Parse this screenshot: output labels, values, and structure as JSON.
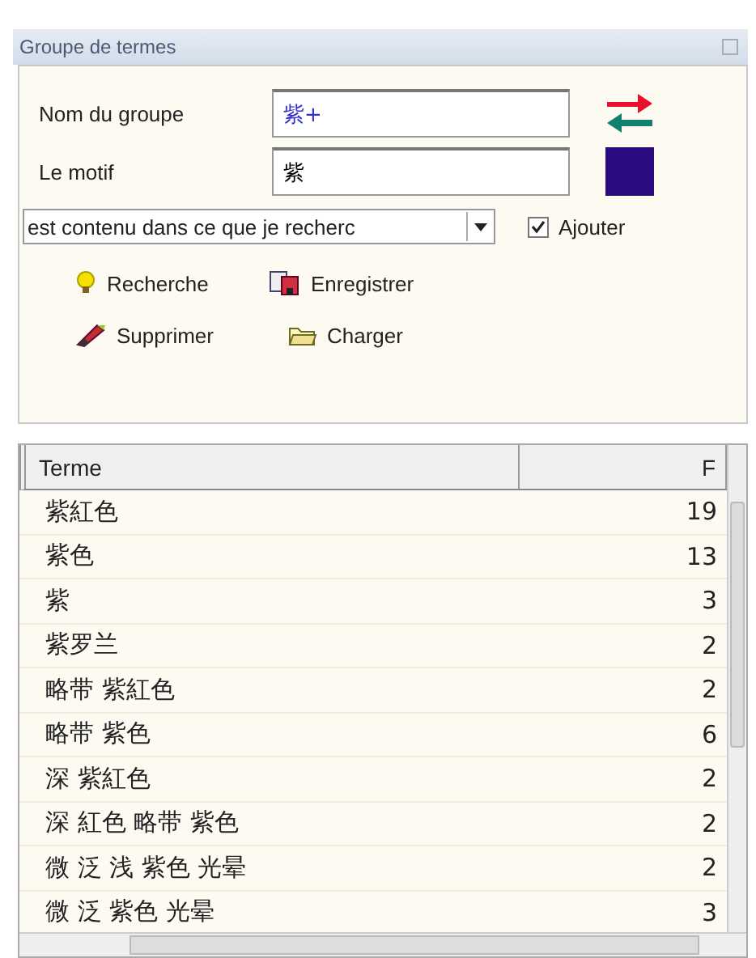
{
  "window": {
    "title": "Groupe de termes"
  },
  "form": {
    "name_label": "Nom du groupe",
    "name_value": "紫+",
    "pattern_label": "Le motif",
    "pattern_value": "紫",
    "match_mode": "est contenu dans ce que je recherc",
    "add": {
      "label": "Ajouter",
      "checked": true
    }
  },
  "actions": [
    {
      "label": "Recherche",
      "kind": "search"
    },
    {
      "label": "Enregistrer",
      "kind": "save"
    },
    {
      "label": "Supprimer",
      "kind": "delete"
    },
    {
      "label": "Charger",
      "kind": "load"
    }
  ],
  "table": {
    "columns": [
      "Terme",
      "F"
    ],
    "rows": [
      [
        "紫紅色",
        "19"
      ],
      [
        "紫色",
        "13"
      ],
      [
        "紫",
        "3"
      ],
      [
        "紫罗兰",
        "2"
      ],
      [
        "略带 紫紅色",
        "2"
      ],
      [
        "略带 紫色",
        "6"
      ],
      [
        "深 紫紅色",
        "2"
      ],
      [
        "深 紅色 略带 紫色",
        "2"
      ],
      [
        "微 泛 浅 紫色 光晕",
        "2"
      ],
      [
        "微 泛 紫色 光晕",
        "3"
      ]
    ]
  }
}
